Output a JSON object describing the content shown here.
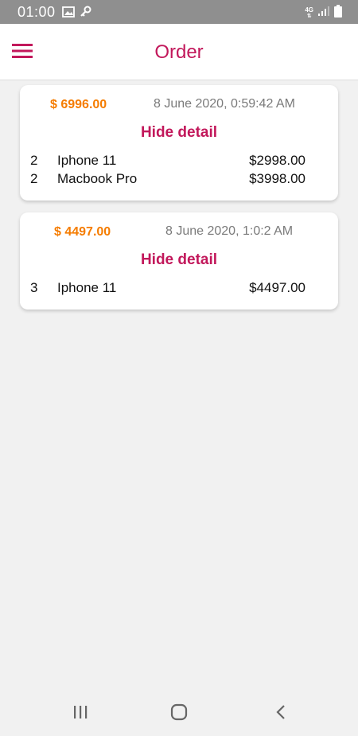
{
  "status_bar": {
    "time": "01:00",
    "network": "4G",
    "icons": [
      "image-icon",
      "key-icon",
      "signal-icon",
      "battery-icon"
    ]
  },
  "app_bar": {
    "title": "Order",
    "menu_icon": "hamburger-menu-icon"
  },
  "colors": {
    "accent": "#c2185b",
    "total": "#f57c00",
    "date": "#7a7a7a",
    "background": "#f1f1f1"
  },
  "orders": [
    {
      "total": "$ 6996.00",
      "date": "8 June 2020, 0:59:42 AM",
      "toggle_label": "Hide detail",
      "items": [
        {
          "qty": "2",
          "name": "Iphone 11",
          "price": "$2998.00"
        },
        {
          "qty": "2",
          "name": "Macbook Pro",
          "price": "$3998.00"
        }
      ]
    },
    {
      "total": "$ 4497.00",
      "date": "8 June 2020, 1:0:2 AM",
      "toggle_label": "Hide detail",
      "items": [
        {
          "qty": "3",
          "name": "Iphone 11",
          "price": "$4497.00"
        }
      ]
    }
  ],
  "nav_bar": {
    "icons": [
      "recent-apps-icon",
      "home-icon",
      "back-icon"
    ]
  }
}
